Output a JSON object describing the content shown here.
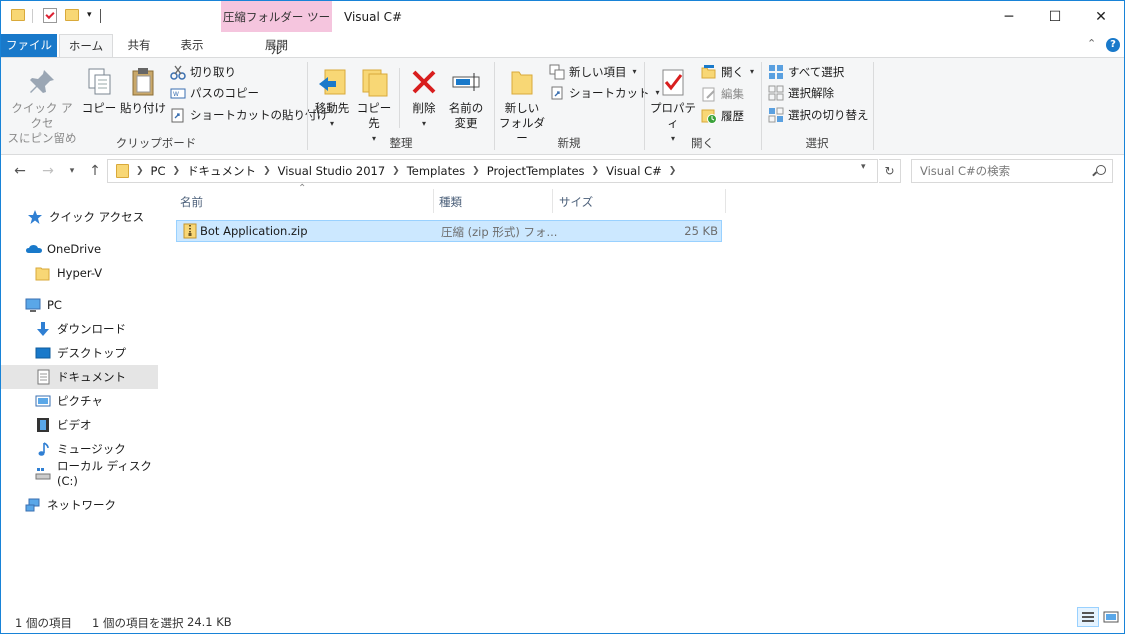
{
  "window": {
    "title": "Visual C#",
    "contextual_tab_group": "圧縮フォルダー ツール",
    "controls": {
      "minimize": "─",
      "maximize": "☐",
      "close": "✕"
    }
  },
  "ribbon_tabs": {
    "file": "ファイル",
    "home": "ホーム",
    "share": "共有",
    "view": "表示",
    "extract": "展開"
  },
  "ribbon": {
    "clipboard": {
      "label": "クリップボード",
      "pin_line1": "クイック アクセ",
      "pin_line2": "スにピン留め",
      "copy": "コピー",
      "paste": "貼り付け",
      "cut": "切り取り",
      "copy_path": "パスのコピー",
      "paste_shortcut": "ショートカットの貼り付け"
    },
    "organize": {
      "label": "整理",
      "move_to": "移動先",
      "copy_to": "コピー先",
      "delete": "削除",
      "rename_line1": "名前の",
      "rename_line2": "変更"
    },
    "new": {
      "label": "新規",
      "new_folder_line1": "新しい",
      "new_folder_line2": "フォルダー",
      "new_item": "新しい項目",
      "easy_access": "ショートカット"
    },
    "open": {
      "label": "開く",
      "properties": "プロパティ",
      "open": "開く",
      "edit": "編集",
      "history": "履歴"
    },
    "select": {
      "label": "選択",
      "select_all": "すべて選択",
      "select_none": "選択解除",
      "invert": "選択の切り替え"
    }
  },
  "address": {
    "breadcrumbs": [
      "PC",
      "ドキュメント",
      "Visual Studio 2017",
      "Templates",
      "ProjectTemplates",
      "Visual C#"
    ],
    "search_placeholder": "Visual C#の検索",
    "back": "←",
    "forward": "→",
    "up": "↑",
    "refresh": "↻"
  },
  "nav_pane": {
    "quick_access": "クイック アクセス",
    "onedrive": "OneDrive",
    "hyperv": "Hyper-V",
    "pc": "PC",
    "downloads": "ダウンロード",
    "desktop": "デスクトップ",
    "documents": "ドキュメント",
    "pictures": "ピクチャ",
    "videos": "ビデオ",
    "music": "ミュージック",
    "local_disk": "ローカル ディスク (C:)",
    "network": "ネットワーク"
  },
  "columns": {
    "name": "名前",
    "type": "種類",
    "size": "サイズ"
  },
  "files": [
    {
      "name": "Bot Application.zip",
      "type": "圧縮 (zip 形式) フォ...",
      "size": "25 KB"
    }
  ],
  "status": {
    "item_count": "1 個の項目",
    "selection": "1 個の項目を選択",
    "selection_size": "24.1 KB"
  },
  "colors": {
    "accent": "#1979ca",
    "contextual_tab": "#f5c5de",
    "selection_fill": "#cce8ff",
    "selection_border": "#99d1ff"
  }
}
